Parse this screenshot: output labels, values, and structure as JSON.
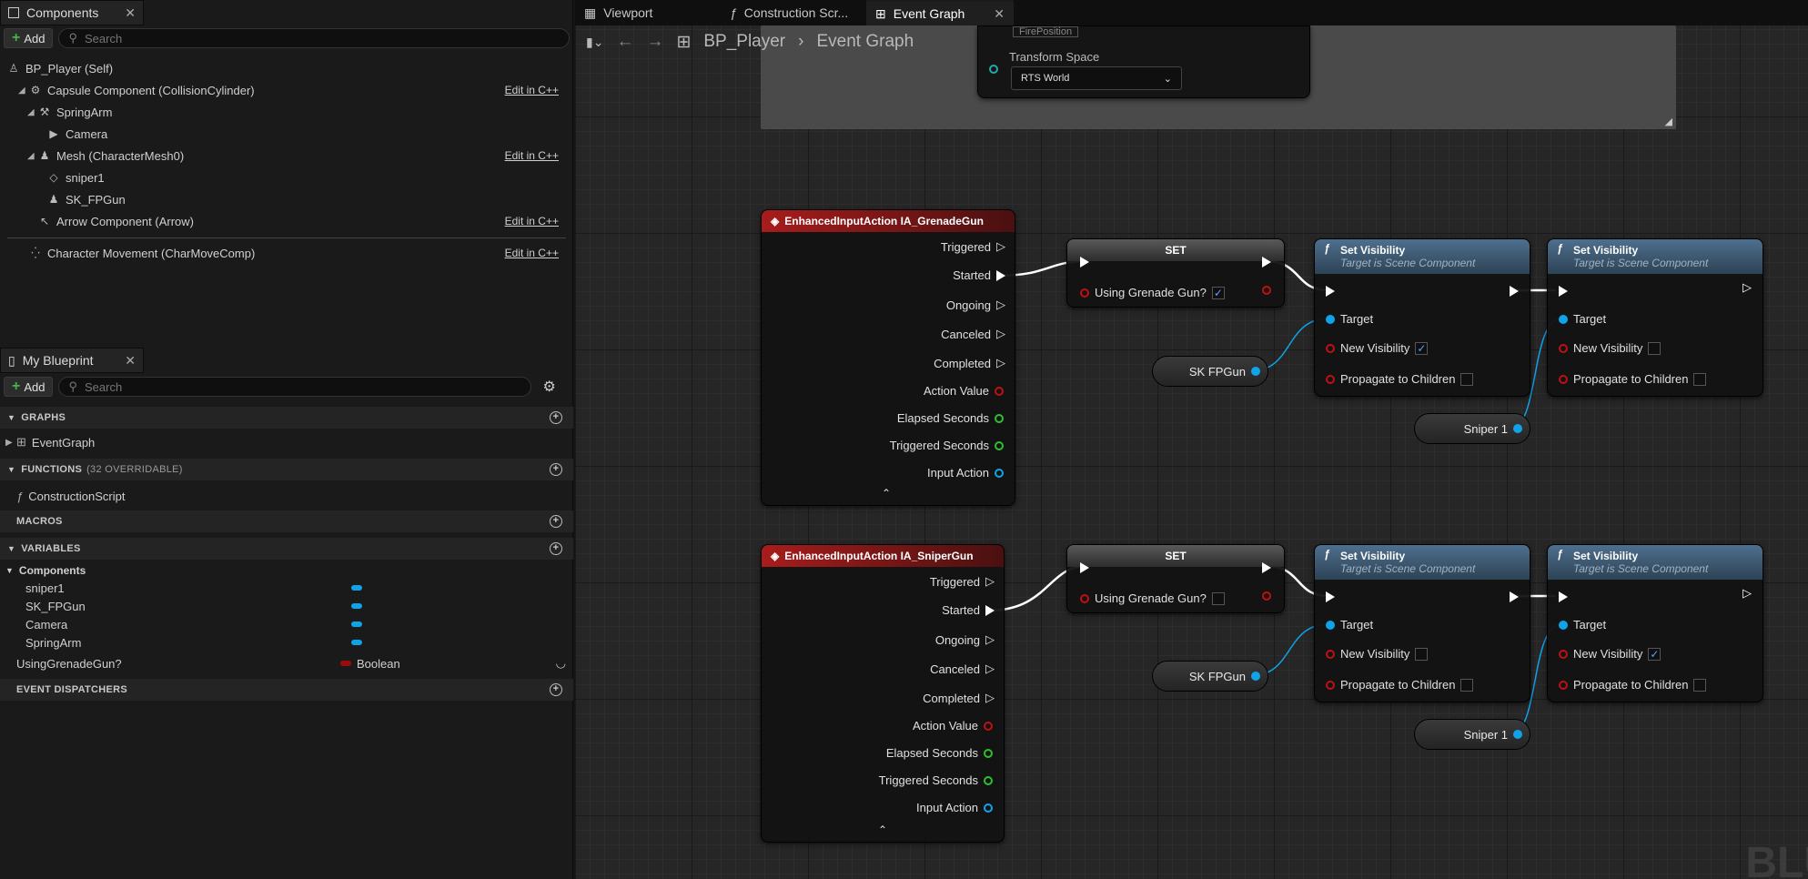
{
  "components_panel": {
    "title": "Components",
    "add_label": "Add",
    "search_placeholder": "Search",
    "items": [
      {
        "label": "BP_Player (Self)",
        "edit": ""
      },
      {
        "label": "Capsule Component (CollisionCylinder)",
        "edit": "Edit in C++"
      },
      {
        "label": "SpringArm",
        "edit": ""
      },
      {
        "label": "Camera",
        "edit": ""
      },
      {
        "label": "Mesh (CharacterMesh0)",
        "edit": "Edit in C++"
      },
      {
        "label": "sniper1",
        "edit": ""
      },
      {
        "label": "SK_FPGun",
        "edit": ""
      },
      {
        "label": "Arrow Component (Arrow)",
        "edit": "Edit in C++"
      },
      {
        "label": "Character Movement (CharMoveComp)",
        "edit": "Edit in C++"
      }
    ]
  },
  "my_blueprint": {
    "title": "My Blueprint",
    "add_label": "Add",
    "search_placeholder": "Search",
    "sections": {
      "graphs": "GRAPHS",
      "functions": "FUNCTIONS",
      "functions_note": "(32 OVERRIDABLE)",
      "macros": "MACROS",
      "variables": "VARIABLES",
      "event_dispatchers": "EVENT DISPATCHERS"
    },
    "graph_item": "EventGraph",
    "function_item": "ConstructionScript",
    "var_group": "Components",
    "vars": [
      "sniper1",
      "SK_FPGun",
      "Camera",
      "SpringArm"
    ],
    "bool_var": "UsingGrenadeGun?",
    "bool_type": "Boolean"
  },
  "editor_tabs": [
    "Viewport",
    "Construction Scr...",
    "Event Graph"
  ],
  "breadcrumb": {
    "blueprint": "BP_Player",
    "graph": "Event Graph"
  },
  "top_node": {
    "field": "FirePosition",
    "label": "Transform Space",
    "value": "RTS World"
  },
  "nodes": {
    "event1_title": "EnhancedInputAction IA_GrenadeGun",
    "event2_title": "EnhancedInputAction IA_SniperGun",
    "event_pins": [
      "Triggered",
      "Started",
      "Ongoing",
      "Canceled",
      "Completed",
      "Action Value",
      "Elapsed Seconds",
      "Triggered Seconds",
      "Input Action"
    ],
    "set_title": "SET",
    "set_var": "Using Grenade Gun?",
    "setvis_title": "Set Visibility",
    "setvis_sub": "Target is Scene Component",
    "setvis_pins": [
      "Target",
      "New Visibility",
      "Propagate to Children"
    ],
    "var_sk": "SK FPGun",
    "var_sniper": "Sniper 1"
  },
  "watermark": "BLU"
}
